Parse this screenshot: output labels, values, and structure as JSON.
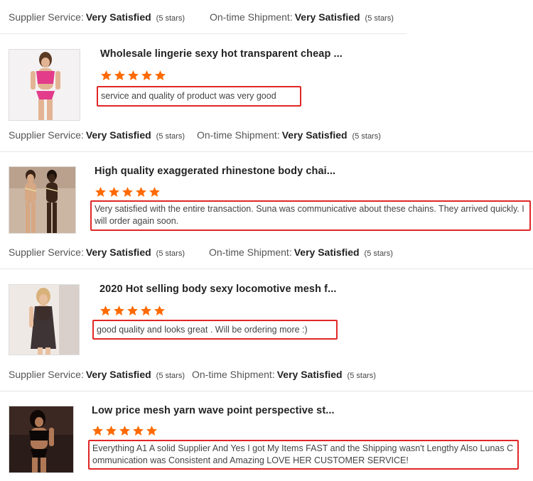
{
  "colors": {
    "star": "#ff6a00",
    "highlight_border": "#e02727"
  },
  "summary_labels": {
    "supplier": "Supplier Service:",
    "shipment": "On-time Shipment:"
  },
  "top_summary": {
    "supplier_value": "Very Satisfied",
    "supplier_stars": "(5 stars)",
    "shipment_value": "Very Satisfied",
    "shipment_stars": "(5 stars)"
  },
  "reviews": [
    {
      "product_title": "Wholesale lingerie sexy hot transparent cheap ...",
      "rating": 5,
      "comment": "service and quality of product was very good",
      "summary": {
        "supplier_value": "Very Satisfied",
        "supplier_stars": "(5 stars)",
        "shipment_value": "Very Satisfied",
        "shipment_stars": "(5 stars)"
      }
    },
    {
      "product_title": "High quality exaggerated rhinestone body chai...",
      "rating": 5,
      "comment": "Very satisfied with the entire transaction.  Suna was communicative about these chains.  They arrived quickly.  I will order again soon.",
      "summary": {
        "supplier_value": "Very Satisfied",
        "supplier_stars": "(5 stars)",
        "shipment_value": "Very Satisfied",
        "shipment_stars": "(5 stars)"
      }
    },
    {
      "product_title": "2020 Hot selling body sexy locomotive mesh f...",
      "rating": 5,
      "comment": "good quality  and looks great . Will be ordering more :)",
      "summary": {
        "supplier_value": "Very Satisfied",
        "supplier_stars": "(5 stars)",
        "shipment_value": "Very Satisfied",
        "shipment_stars": "(5 stars)"
      }
    },
    {
      "product_title": "Low price mesh yarn wave point perspective st...",
      "rating": 5,
      "comment": "Everything A1  A solid Supplier And Yes I got My Items FAST and the Shipping wasn't Lengthy Also Lunas Communication was Consistent and Amazing LOVE HER CUSTOMER SERVICE!"
    }
  ]
}
